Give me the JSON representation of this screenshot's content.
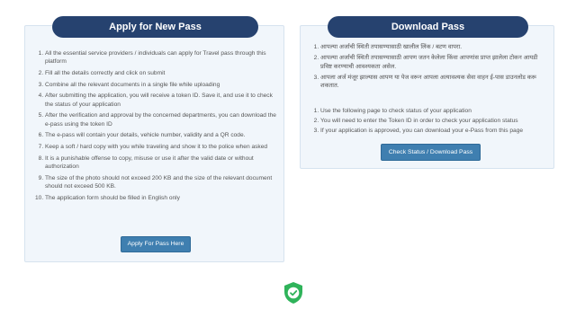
{
  "apply": {
    "title": "Apply for New Pass",
    "items": [
      "All the essential service providers / individuals can apply for Travel pass through this platform",
      "Fill all the details correctly and click on submit",
      "Combine all the relevant documents in a single file while uploading",
      "After submitting the application, you will receive a token ID. Save it, and use it to check the status of your application",
      "After the verification and approval by the concerned departments, you can download the e-pass using the token ID",
      "The e-pass will contain your details, vehicle number, validity and a QR code.",
      "Keep a soft / hard copy with you while traveling and show it to the police when asked",
      "It is a punishable offense to copy, misuse or use it after the valid date or without authorization",
      "The size of the photo should not exceed 200 KB and the size of the relevant document should not exceed 500 KB.",
      "The application form should be filled in English only"
    ],
    "button_label": "Apply For Pass Here"
  },
  "download": {
    "title": "Download Pass",
    "marathi_items": [
      "आपल्या अर्जाची स्थिती तपासण्यासाठी खालील लिंक / बटण वापरा.",
      "आपल्या अर्जाची स्थिती तपासण्यासाठी आपण जतन केलेला किंवा आपणांस प्राप्त झालेला टोकन आयडी प्रविष्ट करण्याची आवश्यकता असेल.",
      "आपला अर्ज मंजूर झाल्यास आपण या पेज वरून आपला अत्यावश्यक सेवा वाहन ई-पास डाउनलोड करू शकतात."
    ],
    "english_items": [
      "Use the following page to check status of your application",
      "You will need to enter the Token ID in order to check your application status",
      "If your application is approved, you can download your e-Pass from this page"
    ],
    "button_label": "Check Status / Download Pass"
  },
  "footer": {
    "icon": "shield-check-icon",
    "icon_color": "#2fb35a"
  }
}
